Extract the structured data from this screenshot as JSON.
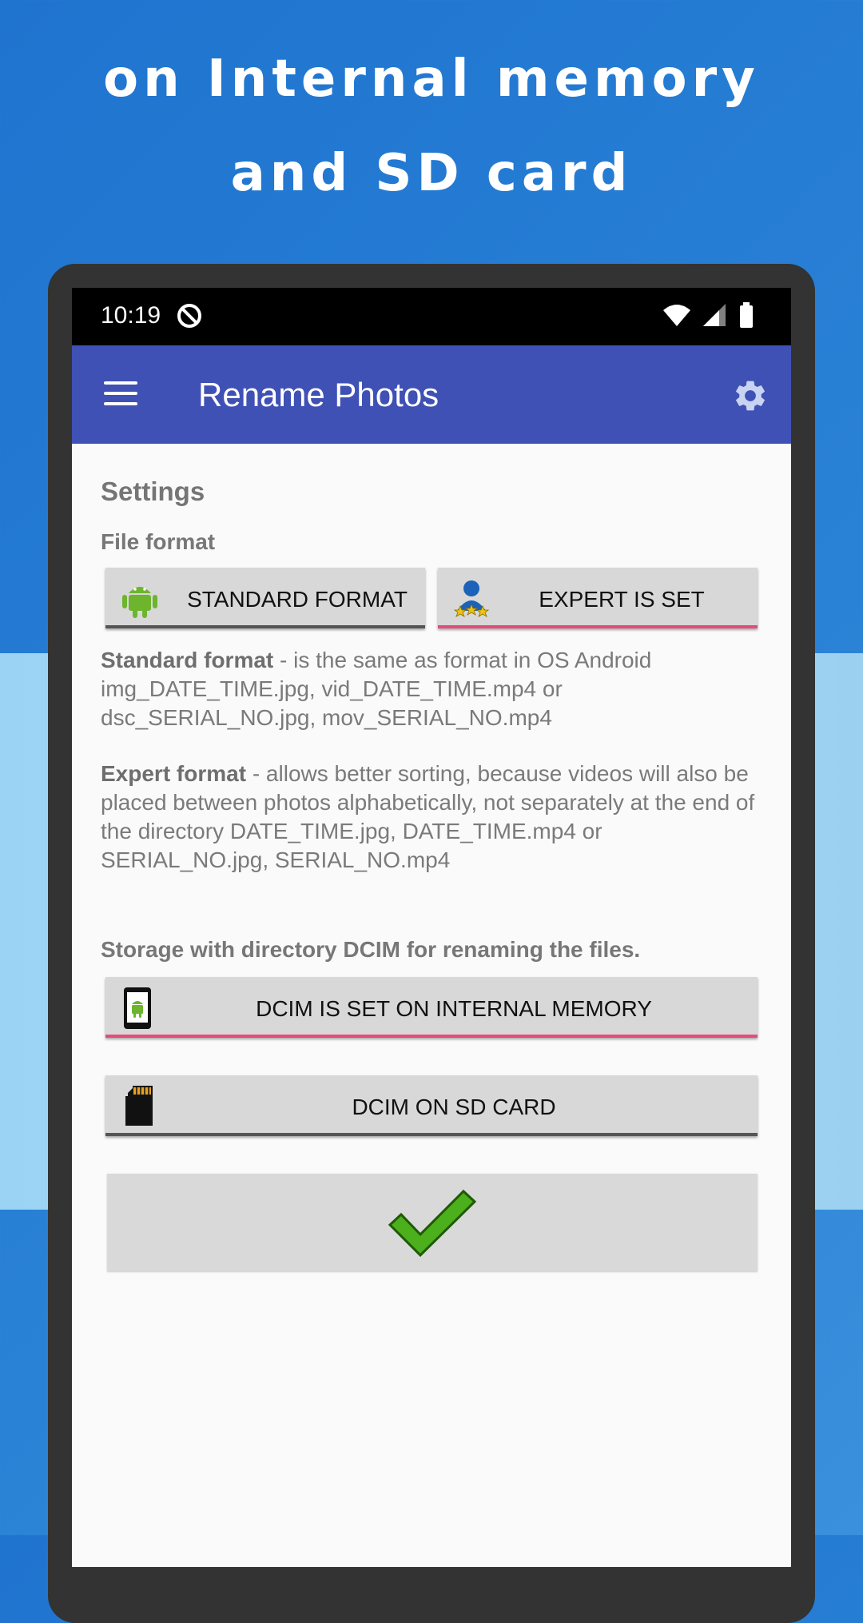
{
  "headline": {
    "line1": "on Internal memory",
    "line2": "and SD card"
  },
  "status_bar": {
    "time": "10:19"
  },
  "app_bar": {
    "title": "Rename Photos"
  },
  "settings": {
    "title": "Settings",
    "file_format_label": "File format",
    "standard_button": "STANDARD FORMAT",
    "expert_button": "EXPERT IS SET",
    "standard_desc_bold": "Standard format",
    "standard_desc_text": " - is the same as format in OS Android img_DATE_TIME.jpg, vid_DATE_TIME.mp4 or dsc_SERIAL_NO.jpg, mov_SERIAL_NO.mp4",
    "expert_desc_bold": "Expert format",
    "expert_desc_text": " - allows better sorting, because videos will also be placed between photos alphabetically, not separately at the end of the directory DATE_TIME.jpg, DATE_TIME.mp4 or SERIAL_NO.jpg, SERIAL_NO.mp4",
    "storage_label": "Storage with directory DCIM for renaming the files.",
    "internal_button": "DCIM IS SET ON INTERNAL MEMORY",
    "sd_button": "DCIM ON SD CARD"
  },
  "colors": {
    "app_bar": "#3f51b5",
    "selected_underline": "#e84a7b",
    "unselected_underline": "#555555",
    "check_green": "#4caf1c"
  },
  "icons": [
    "menu-icon",
    "gear-icon",
    "android-icon",
    "expert-user-icon",
    "phone-android-icon",
    "sd-card-icon",
    "checkmark-icon",
    "wifi-icon",
    "signal-icon",
    "battery-icon"
  ]
}
